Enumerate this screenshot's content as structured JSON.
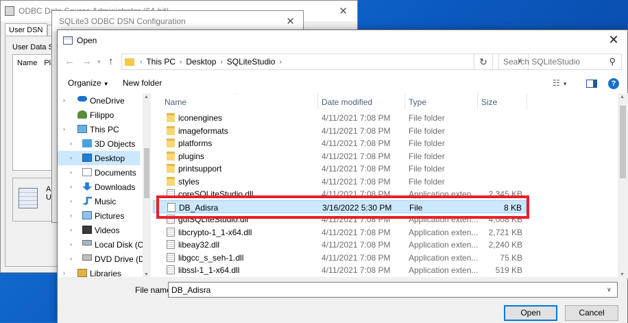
{
  "odbc": {
    "title": "ODBC Data Source Administrator (64-bit)",
    "tab_user_dsn": "User DSN",
    "tab_system_dsn": "Sys",
    "label": "User Data Sou",
    "col_name": "Name",
    "col_platform": "Platf",
    "info_line1": "An",
    "info_line2": "Us"
  },
  "sqlite_config": {
    "title": "SQLite3 ODBC DSN Configuration"
  },
  "open_dialog": {
    "title": "Open",
    "address": [
      "This PC",
      "Desktop",
      "SQLiteStudio"
    ],
    "search_placeholder": "Search SQLiteStudio",
    "toolbar": {
      "organize": "Organize",
      "new_folder": "New folder"
    },
    "sidebar": [
      {
        "label": "OneDrive",
        "icon": "cloud-icon"
      },
      {
        "label": "Filippo",
        "icon": "user-icon"
      },
      {
        "label": "This PC",
        "icon": "computer-icon"
      },
      {
        "label": "3D Objects",
        "icon": "cube-icon"
      },
      {
        "label": "Desktop",
        "icon": "desktop-icon",
        "selected": true
      },
      {
        "label": "Documents",
        "icon": "documents-icon"
      },
      {
        "label": "Downloads",
        "icon": "download-icon"
      },
      {
        "label": "Music",
        "icon": "music-icon"
      },
      {
        "label": "Pictures",
        "icon": "pictures-icon"
      },
      {
        "label": "Videos",
        "icon": "videos-icon"
      },
      {
        "label": "Local Disk (C:)",
        "icon": "disk-icon"
      },
      {
        "label": "DVD Drive (D:)",
        "icon": "dvd-icon"
      },
      {
        "label": "Libraries",
        "icon": "libraries-icon"
      }
    ],
    "columns": {
      "name": "Name",
      "date": "Date modified",
      "type": "Type",
      "size": "Size"
    },
    "files": [
      {
        "name": "iconengines",
        "date": "4/11/2021 7:08 PM",
        "type": "File folder",
        "size": "",
        "kind": "folder"
      },
      {
        "name": "imageformats",
        "date": "4/11/2021 7:08 PM",
        "type": "File folder",
        "size": "",
        "kind": "folder"
      },
      {
        "name": "platforms",
        "date": "4/11/2021 7:08 PM",
        "type": "File folder",
        "size": "",
        "kind": "folder"
      },
      {
        "name": "plugins",
        "date": "4/11/2021 7:08 PM",
        "type": "File folder",
        "size": "",
        "kind": "folder"
      },
      {
        "name": "printsupport",
        "date": "4/11/2021 7:08 PM",
        "type": "File folder",
        "size": "",
        "kind": "folder"
      },
      {
        "name": "styles",
        "date": "4/11/2021 7:08 PM",
        "type": "File folder",
        "size": "",
        "kind": "folder"
      },
      {
        "name": "coreSQLiteStudio.dll",
        "date": "4/11/2021 7:08 PM",
        "type": "Application exten...",
        "size": "2,345 KB",
        "kind": "dll"
      },
      {
        "name": "DB_Adisra",
        "date": "3/16/2022 5:30 PM",
        "type": "File",
        "size": "8 KB",
        "kind": "file",
        "selected": true
      },
      {
        "name": "guiSQLiteStudio.dll",
        "date": "4/11/2021 7:08 PM",
        "type": "Application exten...",
        "size": "4,008 KB",
        "kind": "dll"
      },
      {
        "name": "libcrypto-1_1-x64.dll",
        "date": "4/11/2021 7:08 PM",
        "type": "Application exten...",
        "size": "2,721 KB",
        "kind": "dll"
      },
      {
        "name": "libeay32.dll",
        "date": "4/11/2021 7:08 PM",
        "type": "Application exten...",
        "size": "2,240 KB",
        "kind": "dll"
      },
      {
        "name": "libgcc_s_seh-1.dll",
        "date": "4/11/2021 7:08 PM",
        "type": "Application exten...",
        "size": "75 KB",
        "kind": "dll"
      },
      {
        "name": "libssl-1_1-x64.dll",
        "date": "4/11/2021 7:08 PM",
        "type": "Application exten...",
        "size": "519 KB",
        "kind": "dll"
      }
    ],
    "file_name_label": "File name:",
    "file_name_value": "DB_Adisra",
    "open_label": "Open",
    "cancel_label": "Cancel"
  },
  "colors": {
    "selection": "#cce8ff",
    "highlight_box": "#e8202a",
    "accent": "#0078d7"
  }
}
